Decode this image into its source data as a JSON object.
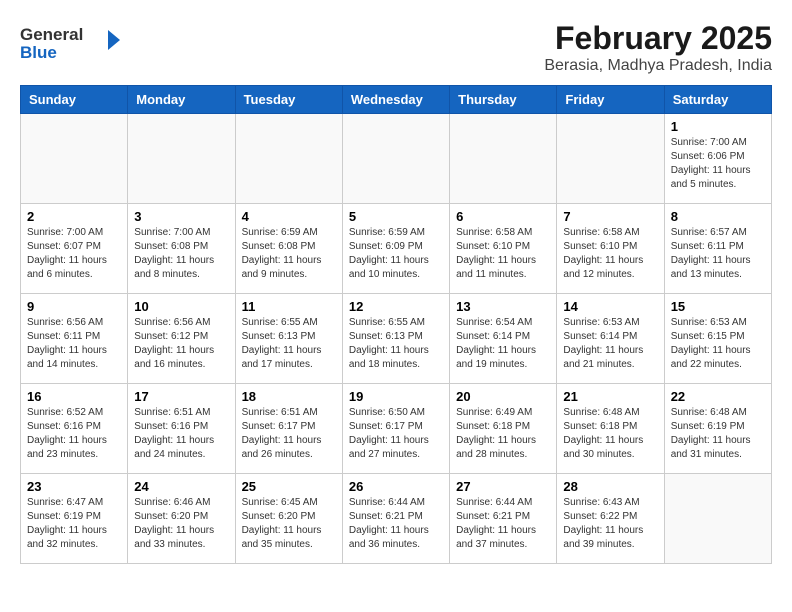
{
  "header": {
    "logo_general": "General",
    "logo_blue": "Blue",
    "title": "February 2025",
    "subtitle": "Berasia, Madhya Pradesh, India"
  },
  "weekdays": [
    "Sunday",
    "Monday",
    "Tuesday",
    "Wednesday",
    "Thursday",
    "Friday",
    "Saturday"
  ],
  "weeks": [
    [
      {
        "day": "",
        "sunrise": "",
        "sunset": "",
        "daylight": ""
      },
      {
        "day": "",
        "sunrise": "",
        "sunset": "",
        "daylight": ""
      },
      {
        "day": "",
        "sunrise": "",
        "sunset": "",
        "daylight": ""
      },
      {
        "day": "",
        "sunrise": "",
        "sunset": "",
        "daylight": ""
      },
      {
        "day": "",
        "sunrise": "",
        "sunset": "",
        "daylight": ""
      },
      {
        "day": "",
        "sunrise": "",
        "sunset": "",
        "daylight": ""
      },
      {
        "day": "1",
        "sunrise": "7:00 AM",
        "sunset": "6:06 PM",
        "daylight": "11 hours and 5 minutes."
      }
    ],
    [
      {
        "day": "2",
        "sunrise": "7:00 AM",
        "sunset": "6:07 PM",
        "daylight": "11 hours and 6 minutes."
      },
      {
        "day": "3",
        "sunrise": "7:00 AM",
        "sunset": "6:08 PM",
        "daylight": "11 hours and 8 minutes."
      },
      {
        "day": "4",
        "sunrise": "6:59 AM",
        "sunset": "6:08 PM",
        "daylight": "11 hours and 9 minutes."
      },
      {
        "day": "5",
        "sunrise": "6:59 AM",
        "sunset": "6:09 PM",
        "daylight": "11 hours and 10 minutes."
      },
      {
        "day": "6",
        "sunrise": "6:58 AM",
        "sunset": "6:10 PM",
        "daylight": "11 hours and 11 minutes."
      },
      {
        "day": "7",
        "sunrise": "6:58 AM",
        "sunset": "6:10 PM",
        "daylight": "11 hours and 12 minutes."
      },
      {
        "day": "8",
        "sunrise": "6:57 AM",
        "sunset": "6:11 PM",
        "daylight": "11 hours and 13 minutes."
      }
    ],
    [
      {
        "day": "9",
        "sunrise": "6:56 AM",
        "sunset": "6:11 PM",
        "daylight": "11 hours and 14 minutes."
      },
      {
        "day": "10",
        "sunrise": "6:56 AM",
        "sunset": "6:12 PM",
        "daylight": "11 hours and 16 minutes."
      },
      {
        "day": "11",
        "sunrise": "6:55 AM",
        "sunset": "6:13 PM",
        "daylight": "11 hours and 17 minutes."
      },
      {
        "day": "12",
        "sunrise": "6:55 AM",
        "sunset": "6:13 PM",
        "daylight": "11 hours and 18 minutes."
      },
      {
        "day": "13",
        "sunrise": "6:54 AM",
        "sunset": "6:14 PM",
        "daylight": "11 hours and 19 minutes."
      },
      {
        "day": "14",
        "sunrise": "6:53 AM",
        "sunset": "6:14 PM",
        "daylight": "11 hours and 21 minutes."
      },
      {
        "day": "15",
        "sunrise": "6:53 AM",
        "sunset": "6:15 PM",
        "daylight": "11 hours and 22 minutes."
      }
    ],
    [
      {
        "day": "16",
        "sunrise": "6:52 AM",
        "sunset": "6:16 PM",
        "daylight": "11 hours and 23 minutes."
      },
      {
        "day": "17",
        "sunrise": "6:51 AM",
        "sunset": "6:16 PM",
        "daylight": "11 hours and 24 minutes."
      },
      {
        "day": "18",
        "sunrise": "6:51 AM",
        "sunset": "6:17 PM",
        "daylight": "11 hours and 26 minutes."
      },
      {
        "day": "19",
        "sunrise": "6:50 AM",
        "sunset": "6:17 PM",
        "daylight": "11 hours and 27 minutes."
      },
      {
        "day": "20",
        "sunrise": "6:49 AM",
        "sunset": "6:18 PM",
        "daylight": "11 hours and 28 minutes."
      },
      {
        "day": "21",
        "sunrise": "6:48 AM",
        "sunset": "6:18 PM",
        "daylight": "11 hours and 30 minutes."
      },
      {
        "day": "22",
        "sunrise": "6:48 AM",
        "sunset": "6:19 PM",
        "daylight": "11 hours and 31 minutes."
      }
    ],
    [
      {
        "day": "23",
        "sunrise": "6:47 AM",
        "sunset": "6:19 PM",
        "daylight": "11 hours and 32 minutes."
      },
      {
        "day": "24",
        "sunrise": "6:46 AM",
        "sunset": "6:20 PM",
        "daylight": "11 hours and 33 minutes."
      },
      {
        "day": "25",
        "sunrise": "6:45 AM",
        "sunset": "6:20 PM",
        "daylight": "11 hours and 35 minutes."
      },
      {
        "day": "26",
        "sunrise": "6:44 AM",
        "sunset": "6:21 PM",
        "daylight": "11 hours and 36 minutes."
      },
      {
        "day": "27",
        "sunrise": "6:44 AM",
        "sunset": "6:21 PM",
        "daylight": "11 hours and 37 minutes."
      },
      {
        "day": "28",
        "sunrise": "6:43 AM",
        "sunset": "6:22 PM",
        "daylight": "11 hours and 39 minutes."
      },
      {
        "day": "",
        "sunrise": "",
        "sunset": "",
        "daylight": ""
      }
    ]
  ]
}
